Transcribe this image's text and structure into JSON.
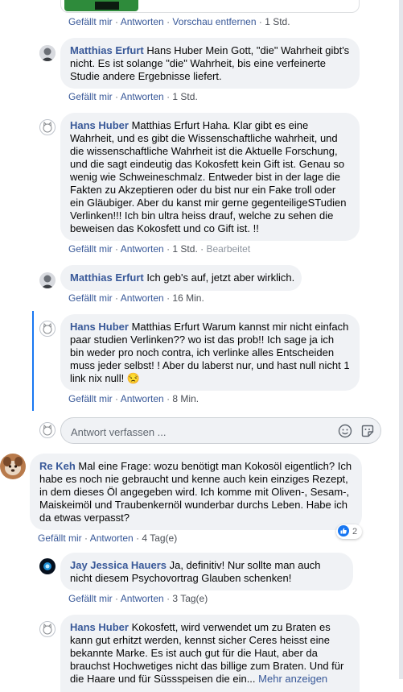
{
  "actions": {
    "like": "Gefällt mir",
    "reply": "Antworten",
    "remove_preview": "Vorschau entfernen",
    "edited": "Bearbeitet",
    "separator": "·"
  },
  "comments": [
    {
      "time": "1 Std."
    },
    {
      "author": "Matthias Erfurt",
      "text": " Hans Huber Mein Gott, \"die\" Wahrheit gibt's nicht. Es ist solange \"die\" Wahrheit, bis eine verfeinerte Studie andere Ergebnisse liefert.",
      "time": "1 Std."
    },
    {
      "author": "Hans Huber",
      "text": " Matthias Erfurt Haha. Klar gibt es eine Wahrheit, und es gibt die Wissenschaftliche wahrheit, und die wissenschaftliche Wahrheit ist die Aktuelle Forschung, und die sagt eindeutig das Kokosfett kein Gift ist. Genau so wenig wie Schweineschmalz. Entweder bist in der lage die Fakten zu Akzeptieren oder du bist nur ein Fake troll oder ein Gläubiger. Aber du kanst mir gerne gegenteiligeSTudien Verlinken!!! Ich bin ultra heiss drauf, welche zu sehen die beweisen das Kokosfett und co Gift ist. !!",
      "time": "1 Std."
    },
    {
      "author": "Matthias Erfurt",
      "text": " Ich geb's auf, jetzt aber wirklich.",
      "time": "16 Min."
    },
    {
      "author": "Hans Huber",
      "text": " Matthias Erfurt Warum kannst mir nicht einfach paar studien Verlinken?? wo ist das prob!! Ich sage ja ich bin weder pro noch contra, ich verlinke alles Entscheiden muss jeder selbst! ! Aber du laberst nur, und hast null nicht 1 link nix null! ",
      "emoji": "😒",
      "time": "8 Min."
    },
    {
      "author": "Re Keh",
      "text": " Mal eine Frage: wozu benötigt man Kokosöl eigentlich? Ich habe es noch nie gebraucht und kenne auch kein einziges Rezept, in dem dieses Öl angegeben wird. Ich komme mit Oliven-, Sesam-, Maiskeimöl und Traubenkernöl wunderbar durchs Leben. Habe ich da etwas verpasst?",
      "time": "4 Tag(e)",
      "likes": "2"
    },
    {
      "author": "Jay Jessica Hauers",
      "text": " Ja, definitiv! Nur sollte man auch nicht diesem Psychovortrag Glauben schenken!",
      "time": "3 Tag(e)"
    },
    {
      "author": "Hans Huber",
      "text": " Kokosfett, wird verwendet um zu Braten es kann gut erhitzt werden, kennst sicher Ceres heisst eine bekannte Marke. Es ist auch gut für die Haut, aber da brauchst Hochwetiges nicht das billige zum Braten. Und für die Haare und für Süssspeisen die ein...",
      "more": "Mehr anzeigen"
    }
  ],
  "reply_input": {
    "placeholder": "Antwort verfassen ..."
  },
  "icons": {
    "emoji": "smiley-icon",
    "sticker": "sticker-icon",
    "like": "thumbs-up-icon"
  },
  "colors": {
    "link": "#385898",
    "bubble": "#f0f2f5",
    "thread_line": "#1877f2",
    "like": "#1877f2"
  }
}
